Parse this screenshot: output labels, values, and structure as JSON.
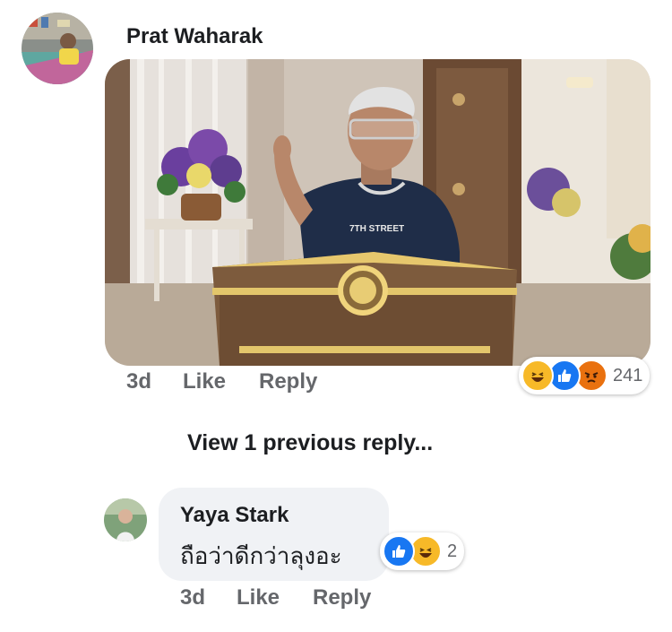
{
  "comment": {
    "author": "Prat Waharak",
    "photo_logo_text": "7TH STREET",
    "time": "3d",
    "like_label": "Like",
    "reply_label": "Reply",
    "reactions": {
      "icons": [
        "haha-emoji-icon",
        "like-thumb-icon",
        "angry-emoji-icon"
      ],
      "count": "241"
    }
  },
  "view_previous": "View 1 previous reply...",
  "reply": {
    "author": "Yaya Stark",
    "text": "ถือว่าดีกว่าลุงอะ",
    "time": "3d",
    "like_label": "Like",
    "reply_label": "Reply",
    "reactions": {
      "icons": [
        "like-thumb-icon",
        "haha-emoji-icon"
      ],
      "count": "2"
    }
  },
  "colors": {
    "like_blue": "#1877f2",
    "haha_yellow": "#f7b928",
    "angry_orange": "#e9710f",
    "secondary_text": "#65676b",
    "bubble_bg": "#f0f2f5"
  }
}
